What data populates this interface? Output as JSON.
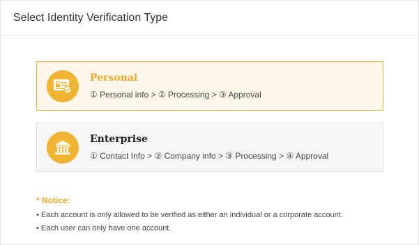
{
  "dialog": {
    "title": "Select Identity Verification Type"
  },
  "options": [
    {
      "title": "Personal",
      "steps": "① Personal info > ② Processing > ③ Approval",
      "icon": "id-card-icon",
      "selected": true
    },
    {
      "title": "Enterprise",
      "steps": "① Contact Info > ② Company info > ③ Processing > ④ Approval",
      "icon": "bank-building-icon",
      "selected": false
    }
  ],
  "notice": {
    "title": "* Notice:",
    "items": [
      "• Each account is only allowed to be verified as either an individual or a corporate account.",
      "• Each user can only have one account."
    ]
  },
  "colors": {
    "accent": "#f0b533",
    "accent_text": "#f0a92a",
    "selected_bg": "#fef8ec",
    "selected_border": "#f0b23e",
    "unselected_bg": "#f7f7f7",
    "unselected_border": "#e2e2e2"
  }
}
